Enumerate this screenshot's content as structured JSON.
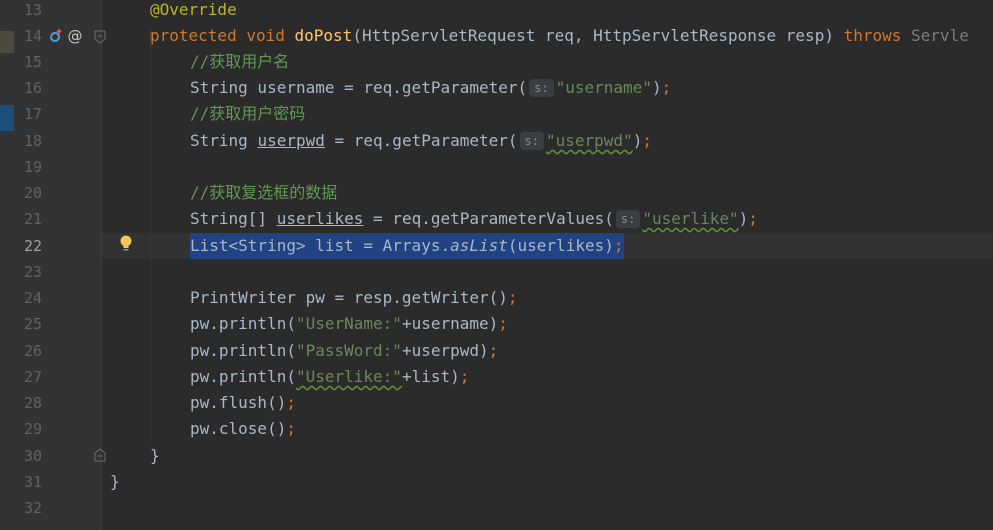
{
  "lines": [
    {
      "no": "13"
    },
    {
      "no": "14"
    },
    {
      "no": "15"
    },
    {
      "no": "16"
    },
    {
      "no": "17"
    },
    {
      "no": "18"
    },
    {
      "no": "19"
    },
    {
      "no": "20"
    },
    {
      "no": "21"
    },
    {
      "no": "22"
    },
    {
      "no": "23"
    },
    {
      "no": "24"
    },
    {
      "no": "25"
    },
    {
      "no": "26"
    },
    {
      "no": "27"
    },
    {
      "no": "28"
    },
    {
      "no": "29"
    },
    {
      "no": "30"
    },
    {
      "no": "31"
    },
    {
      "no": "32"
    }
  ],
  "code": {
    "l13": {
      "annotation": "@Override"
    },
    "l14": {
      "kw1": "protected",
      "kw2": "void",
      "method": "doPost",
      "p1": "(HttpServletRequest req, HttpServletResponse resp) ",
      "throws": "throws",
      "trunc": " Servle"
    },
    "l15": {
      "comment": "//获取用户名"
    },
    "l16": {
      "pre": "String username = req.getParameter(",
      "hint": "s:",
      "str": "\"username\"",
      "post": ")",
      "semi": ";"
    },
    "l17": {
      "comment": "//获取用户密码"
    },
    "l18": {
      "pre1": "String ",
      "var": "userpwd",
      "pre2": " = req.getParameter(",
      "hint": "s:",
      "str": "\"userpwd\"",
      "post": ")",
      "semi": ";"
    },
    "l20": {
      "comment": "//获取复选框的数据"
    },
    "l21": {
      "pre1": "String[] ",
      "var": "userlikes",
      "pre2": " = req.getParameterValues(",
      "hint": "s:",
      "str": "\"userlike\"",
      "post": ")",
      "semi": ";"
    },
    "l22": {
      "pre": "List<String> list = Arrays.",
      "ital": "asList",
      "post": "(userlikes)",
      "semi": ";"
    },
    "l24": {
      "pre": "PrintWriter pw = resp.getWriter()",
      "semi": ";"
    },
    "l25": {
      "pre": "pw.println(",
      "str": "\"UserName:\"",
      "post": "+username)",
      "semi": ";"
    },
    "l26": {
      "pre": "pw.println(",
      "str": "\"PassWord:\"",
      "post": "+userpwd)",
      "semi": ";"
    },
    "l27": {
      "pre": "pw.println(",
      "str": "\"Userlike:\"",
      "post": "+list)",
      "semi": ";"
    },
    "l28": {
      "pre": "pw.flush()",
      "semi": ";"
    },
    "l29": {
      "pre": "pw.close()",
      "semi": ";"
    },
    "l30": {
      "brace": "}"
    },
    "l31": {
      "brace": "}"
    }
  },
  "colors": {
    "background": "#2b2b2b",
    "gutter": "#313335",
    "selection": "#214283",
    "keyword": "#cc7832",
    "string": "#6a8759",
    "method": "#ffc66d"
  }
}
